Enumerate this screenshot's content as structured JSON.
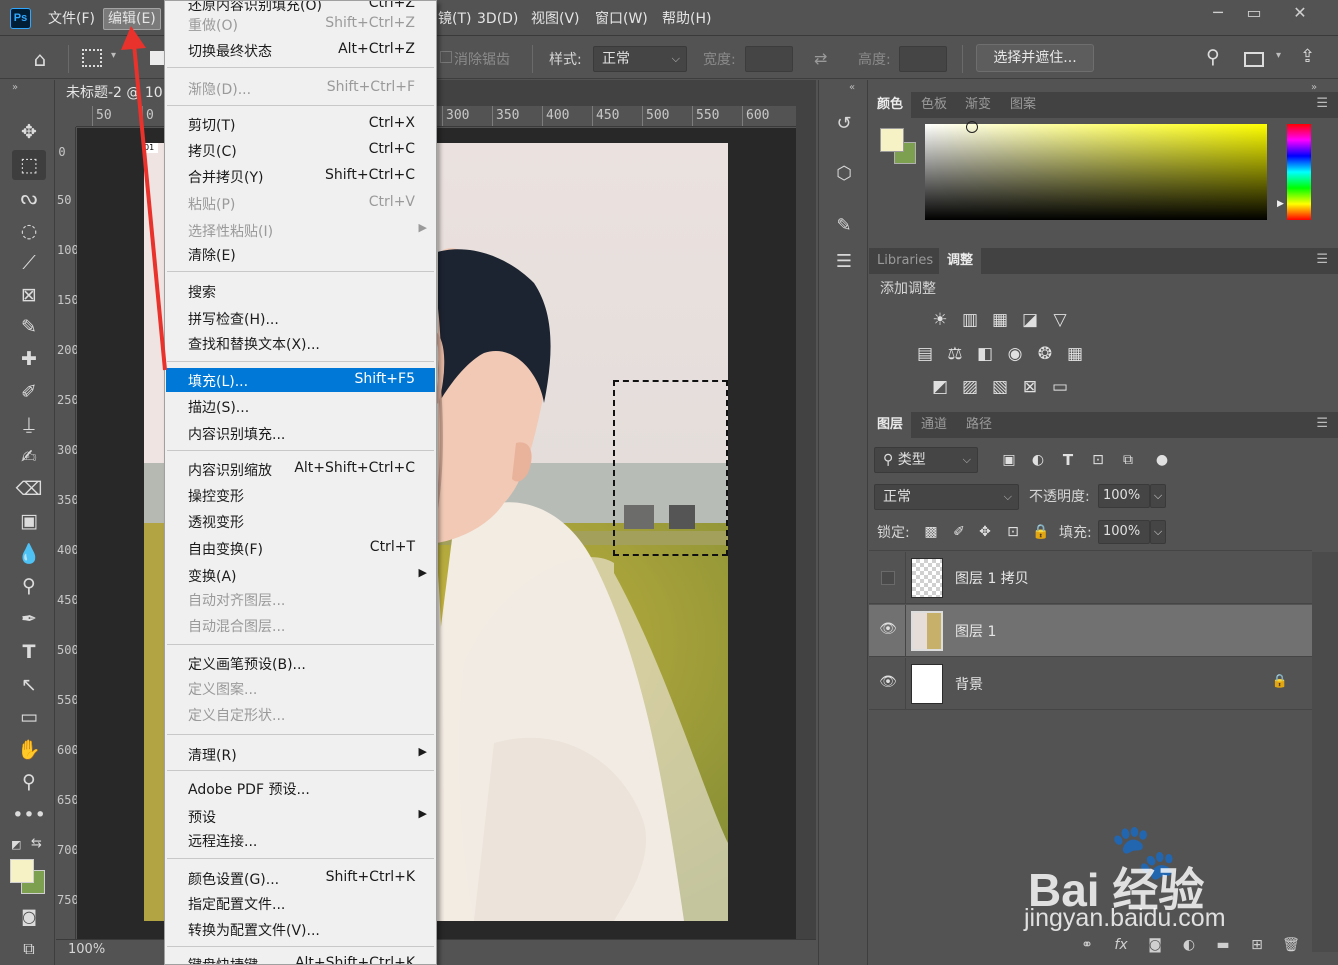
{
  "app": {
    "logo": "Ps",
    "menus": [
      "文件(F)",
      "编辑(E)",
      "图像(I)",
      "图层(L)",
      "文字(Y)",
      "选择(S)",
      "滤镜(T)",
      "3D(D)",
      "视图(V)",
      "窗口(W)",
      "帮助(H)"
    ],
    "visible_menu_labels": {
      "file": "文件(F)",
      "edit": "编辑(E)",
      "filter_tail": "镜(T)",
      "3d": "3D(D)",
      "view": "视图(V)",
      "window": "窗口(W)",
      "help": "帮助(H)"
    },
    "active_menu": "编辑(E)"
  },
  "options_bar": {
    "antialias_label": "消除锯齿",
    "style_label": "样式:",
    "style_value": "正常",
    "width_label": "宽度:",
    "height_label": "高度:",
    "select_mask_button": "选择并遮住..."
  },
  "document": {
    "tab_title": "未标题-2 @ 10",
    "zoom": "100%",
    "ruler_top": [
      "50",
      "0",
      "300",
      "350",
      "400",
      "450",
      "500",
      "550",
      "600"
    ],
    "ruler_left": [
      "0",
      "50",
      "100",
      "150",
      "200",
      "250",
      "300",
      "350",
      "400",
      "450",
      "500",
      "550",
      "600",
      "650",
      "700",
      "750"
    ]
  },
  "edit_menu": {
    "items": [
      {
        "label": "还原内容识别填充(O)",
        "shortcut": "Ctrl+Z",
        "disabled": false
      },
      {
        "label": "重做(O)",
        "shortcut": "Shift+Ctrl+Z",
        "disabled": true
      },
      {
        "label": "切换最终状态",
        "shortcut": "Alt+Ctrl+Z",
        "disabled": false
      },
      {
        "label": "渐隐(D)...",
        "shortcut": "Shift+Ctrl+F",
        "disabled": true
      },
      {
        "label": "剪切(T)",
        "shortcut": "Ctrl+X",
        "disabled": false
      },
      {
        "label": "拷贝(C)",
        "shortcut": "Ctrl+C",
        "disabled": false
      },
      {
        "label": "合并拷贝(Y)",
        "shortcut": "Shift+Ctrl+C",
        "disabled": false
      },
      {
        "label": "粘贴(P)",
        "shortcut": "Ctrl+V",
        "disabled": true
      },
      {
        "label": "选择性粘贴(I)",
        "shortcut": "",
        "disabled": true,
        "submenu": true
      },
      {
        "label": "清除(E)",
        "shortcut": "",
        "disabled": false
      },
      {
        "label": "搜索",
        "shortcut": "",
        "disabled": false
      },
      {
        "label": "拼写检查(H)...",
        "shortcut": "",
        "disabled": false
      },
      {
        "label": "查找和替换文本(X)...",
        "shortcut": "",
        "disabled": false
      },
      {
        "label": "填充(L)...",
        "shortcut": "Shift+F5",
        "disabled": false,
        "highlighted": true
      },
      {
        "label": "描边(S)...",
        "shortcut": "",
        "disabled": false
      },
      {
        "label": "内容识别填充...",
        "shortcut": "",
        "disabled": false
      },
      {
        "label": "内容识别缩放",
        "shortcut": "Alt+Shift+Ctrl+C",
        "disabled": false
      },
      {
        "label": "操控变形",
        "shortcut": "",
        "disabled": false
      },
      {
        "label": "透视变形",
        "shortcut": "",
        "disabled": false
      },
      {
        "label": "自由变换(F)",
        "shortcut": "Ctrl+T",
        "disabled": false
      },
      {
        "label": "变换(A)",
        "shortcut": "",
        "disabled": false,
        "submenu": true
      },
      {
        "label": "自动对齐图层...",
        "shortcut": "",
        "disabled": true
      },
      {
        "label": "自动混合图层...",
        "shortcut": "",
        "disabled": true
      },
      {
        "label": "定义画笔预设(B)...",
        "shortcut": "",
        "disabled": false
      },
      {
        "label": "定义图案...",
        "shortcut": "",
        "disabled": true
      },
      {
        "label": "定义自定形状...",
        "shortcut": "",
        "disabled": true
      },
      {
        "label": "清理(R)",
        "shortcut": "",
        "disabled": false,
        "submenu": true
      },
      {
        "label": "Adobe PDF 预设...",
        "shortcut": "",
        "disabled": false
      },
      {
        "label": "预设",
        "shortcut": "",
        "disabled": false,
        "submenu": true
      },
      {
        "label": "远程连接...",
        "shortcut": "",
        "disabled": false
      },
      {
        "label": "颜色设置(G)...",
        "shortcut": "Shift+Ctrl+K",
        "disabled": false
      },
      {
        "label": "指定配置文件...",
        "shortcut": "",
        "disabled": false
      },
      {
        "label": "转换为配置文件(V)...",
        "shortcut": "",
        "disabled": false
      },
      {
        "label": "键盘快捷键...",
        "shortcut": "Alt+Shift+Ctrl+K",
        "disabled": false
      }
    ]
  },
  "color_panel": {
    "tabs": [
      "颜色",
      "色板",
      "渐变",
      "图案"
    ],
    "foreground": "#f7f2c5",
    "background": "#7da050"
  },
  "adjustments_panel": {
    "tabs": [
      "Libraries",
      "调整"
    ],
    "title": "添加调整"
  },
  "layers_panel": {
    "tabs": [
      "图层",
      "通道",
      "路径"
    ],
    "filter_label": "类型",
    "blend_mode": "正常",
    "opacity_label": "不透明度:",
    "opacity_value": "100%",
    "lock_label": "锁定:",
    "fill_label": "填充:",
    "fill_value": "100%",
    "layers": [
      {
        "name": "图层 1 拷贝",
        "visible": false,
        "selected": false
      },
      {
        "name": "图层 1",
        "visible": true,
        "selected": true
      },
      {
        "name": "背景",
        "visible": true,
        "selected": false,
        "locked": true
      }
    ]
  },
  "watermark": {
    "line1": "Bai 经验",
    "line2": "jingyan.baidu.com"
  }
}
